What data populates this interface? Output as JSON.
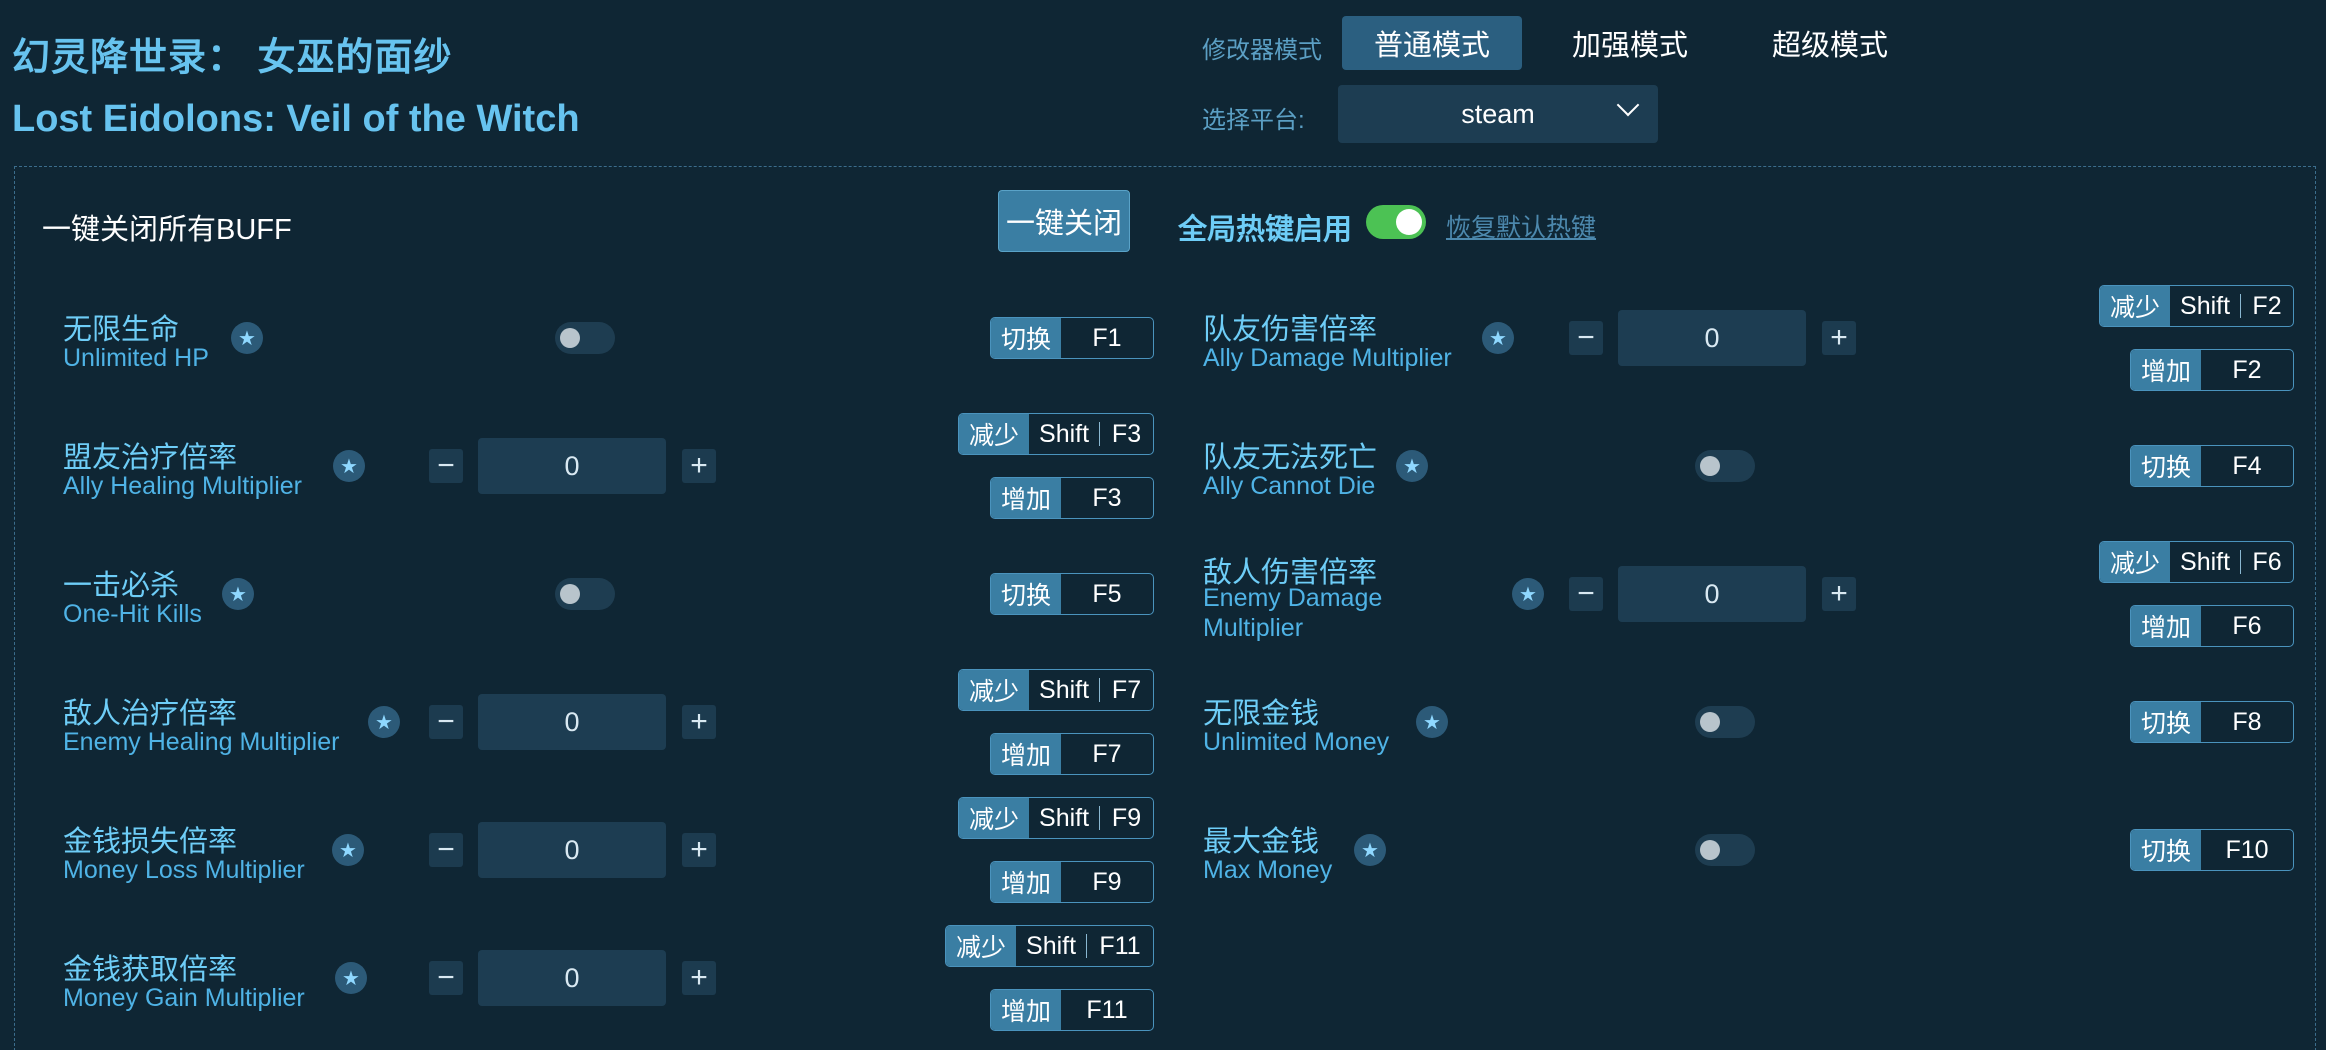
{
  "title_cn": "幻灵降世录： 女巫的面纱",
  "title_en": "Lost Eidolons: Veil of the Witch",
  "mode": {
    "label": "修改器模式",
    "options": [
      "普通模式",
      "加强模式",
      "超级模式"
    ],
    "selected": "普通模式"
  },
  "platform": {
    "label": "选择平台:",
    "value": "steam"
  },
  "toolbar": {
    "onekey_label": "一键关闭所有BUFF",
    "onekey_button": "一键关闭",
    "hotkey_label": "全局热键启用",
    "hotkey_enabled": true,
    "restore_link": "恢复默认热键"
  },
  "left": [
    {
      "cn": "无限生命",
      "en": "Unlimited HP",
      "type": "toggle",
      "on": false,
      "keys": {
        "toggle_tag": "切换",
        "toggle": "F1"
      }
    },
    {
      "cn": "盟友治疗倍率",
      "en": "Ally Healing Multiplier",
      "type": "stepper",
      "value": "0",
      "keys": {
        "dec_tag": "减少",
        "dec_mod": "Shift",
        "dec": "F3",
        "inc_tag": "增加",
        "inc": "F3"
      }
    },
    {
      "cn": "一击必杀",
      "en": "One-Hit Kills",
      "type": "toggle",
      "on": false,
      "keys": {
        "toggle_tag": "切换",
        "toggle": "F5"
      }
    },
    {
      "cn": "敌人治疗倍率",
      "en": "Enemy Healing Multiplier",
      "type": "stepper",
      "value": "0",
      "keys": {
        "dec_tag": "减少",
        "dec_mod": "Shift",
        "dec": "F7",
        "inc_tag": "增加",
        "inc": "F7"
      }
    },
    {
      "cn": "金钱损失倍率",
      "en": "Money Loss Multiplier",
      "type": "stepper",
      "value": "0",
      "keys": {
        "dec_tag": "减少",
        "dec_mod": "Shift",
        "dec": "F9",
        "inc_tag": "增加",
        "inc": "F9"
      }
    },
    {
      "cn": "金钱获取倍率",
      "en": "Money Gain Multiplier",
      "type": "stepper",
      "value": "0",
      "keys": {
        "dec_tag": "减少",
        "dec_mod": "Shift",
        "dec": "F11",
        "inc_tag": "增加",
        "inc": "F11"
      }
    }
  ],
  "right": [
    {
      "cn": "队友伤害倍率",
      "en": "Ally Damage Multiplier",
      "type": "stepper",
      "value": "0",
      "keys": {
        "dec_tag": "减少",
        "dec_mod": "Shift",
        "dec": "F2",
        "inc_tag": "增加",
        "inc": "F2"
      }
    },
    {
      "cn": "队友无法死亡",
      "en": "Ally Cannot Die",
      "type": "toggle",
      "on": false,
      "keys": {
        "toggle_tag": "切换",
        "toggle": "F4"
      }
    },
    {
      "cn": "敌人伤害倍率",
      "en_line1": "Enemy Damage",
      "en_line2": "Multiplier",
      "type": "stepper",
      "value": "0",
      "keys": {
        "dec_tag": "减少",
        "dec_mod": "Shift",
        "dec": "F6",
        "inc_tag": "增加",
        "inc": "F6"
      }
    },
    {
      "cn": "无限金钱",
      "en": "Unlimited Money",
      "type": "toggle",
      "on": false,
      "keys": {
        "toggle_tag": "切换",
        "toggle": "F8"
      }
    },
    {
      "cn": "最大金钱",
      "en": "Max Money",
      "type": "toggle",
      "on": false,
      "keys": {
        "toggle_tag": "切换",
        "toggle": "F10"
      }
    }
  ],
  "icons": {
    "star": "star-icon",
    "minus": "minus-icon",
    "plus": "plus-icon",
    "chevron": "chevron-down-icon"
  },
  "colors": {
    "background": "#0f2634",
    "accent": "#3a7ea3",
    "title": "#67c3ef",
    "toggle_on": "#4cc254"
  }
}
